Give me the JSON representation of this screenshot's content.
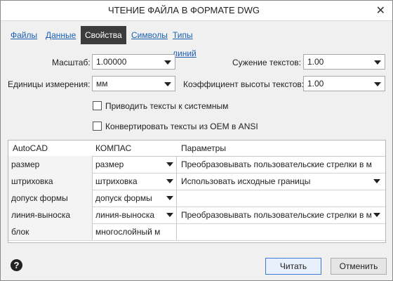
{
  "window": {
    "title": "ЧТЕНИЕ ФАЙЛА В ФОРМАТЕ DWG",
    "close_glyph": "✕"
  },
  "tabs": [
    {
      "label": "Файлы"
    },
    {
      "label": "Данные"
    },
    {
      "label": "Свойства",
      "active": true
    },
    {
      "label": "Символы"
    },
    {
      "label": "Типы линий"
    }
  ],
  "form": {
    "scale_label": "Масштаб:",
    "scale_value": "1.00000",
    "units_label": "Единицы измерения:",
    "units_value": "мм",
    "compress_label": "Сужение текстов:",
    "compress_value": "1.00",
    "height_label": "Коэффициент высоты текстов:",
    "height_value": "1.00",
    "checkbox1": "Приводить тексты к системным",
    "checkbox2": "Конвертировать тексты из OEM в ANSI"
  },
  "grid": {
    "headers": [
      "AutoCAD",
      "КОМПАС",
      "Параметры"
    ],
    "rows": [
      {
        "autocad": "размер",
        "kompas": "размер",
        "params": "Преобразовывать пользовательские стрелки в м"
      },
      {
        "autocad": "штриховка",
        "kompas": "штриховка",
        "params": "Использовать исходные границы"
      },
      {
        "autocad": "допуск формы",
        "kompas": "допуск формы",
        "params": ""
      },
      {
        "autocad": "линия-выноска",
        "kompas": "линия-выноска",
        "params": "Преобразовывать пользовательские стрелки в м"
      },
      {
        "autocad": "блок",
        "kompas": "многослойный м",
        "params": ""
      }
    ]
  },
  "footer": {
    "help_glyph": "?",
    "read_button": "Читать",
    "cancel_button": "Отменить"
  },
  "colors": {
    "accent": "#1a5fb4",
    "active_tab_bg": "#3c3c3c",
    "primary_border": "#3a7bd5"
  }
}
